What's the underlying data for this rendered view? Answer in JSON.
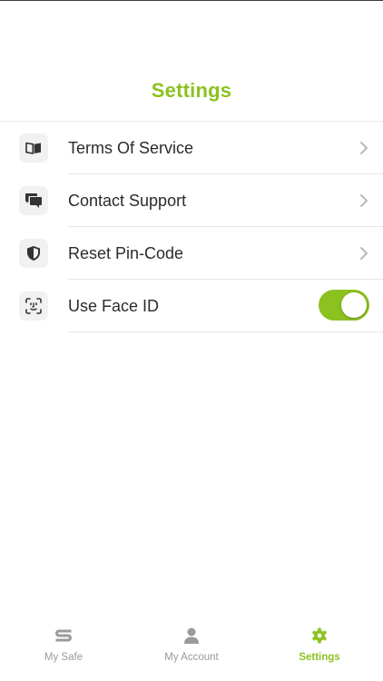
{
  "header": {
    "title": "Settings"
  },
  "colors": {
    "accent": "#8cc21f",
    "icon_tile": "#f1f1f1",
    "tab_inactive": "#9a9a9a"
  },
  "settings": {
    "items": [
      {
        "label": "Terms Of Service",
        "icon": "book-icon",
        "control": "chevron"
      },
      {
        "label": "Contact Support",
        "icon": "chat-bubbles-icon",
        "control": "chevron"
      },
      {
        "label": "Reset Pin-Code",
        "icon": "shield-icon",
        "control": "chevron"
      },
      {
        "label": "Use Face ID",
        "icon": "face-id-icon",
        "control": "toggle",
        "toggle_on": true
      }
    ]
  },
  "tabbar": {
    "tabs": [
      {
        "label": "My Safe",
        "icon": "safe-logo-icon",
        "active": false
      },
      {
        "label": "My Account",
        "icon": "person-icon",
        "active": false
      },
      {
        "label": "Settings",
        "icon": "gear-icon",
        "active": true
      }
    ]
  }
}
